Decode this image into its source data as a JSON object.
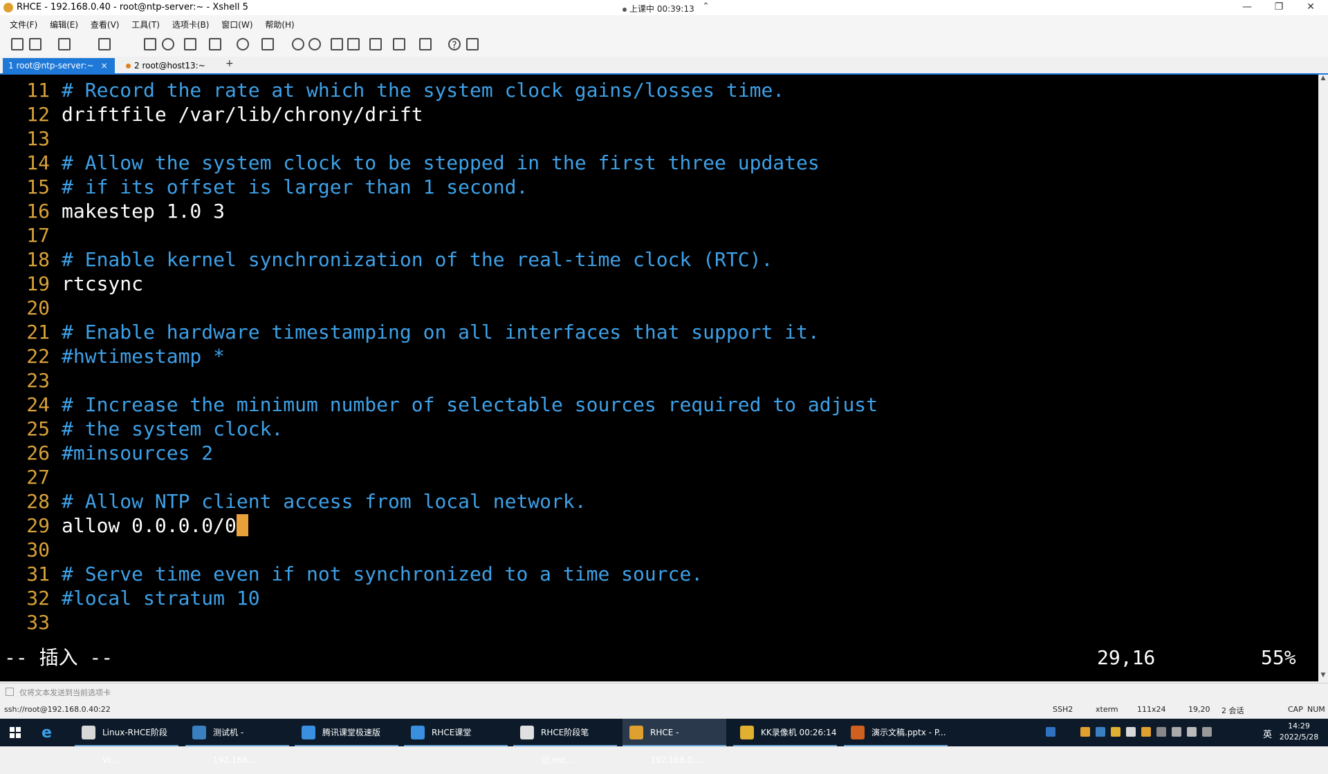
{
  "window": {
    "title": "RHCE - 192.168.0.40 - root@ntp-server:~ - Xshell 5",
    "session_status": "上课中 00:39:13",
    "minimize": "—",
    "restore": "❐",
    "close": "✕"
  },
  "menu": [
    "文件(F)",
    "编辑(E)",
    "查看(V)",
    "工具(T)",
    "选项卡(B)",
    "窗口(W)",
    "帮助(H)"
  ],
  "tabs": [
    {
      "label": "1 root@ntp-server:~",
      "close": "×",
      "active": true
    },
    {
      "label": "2 root@host13:~",
      "active": false
    }
  ],
  "tab_add": "+",
  "terminal": {
    "lines": [
      {
        "num": "11",
        "text": "# Record the rate at which the system clock gains/losses time.",
        "kind": "comment"
      },
      {
        "num": "12",
        "text": "driftfile /var/lib/chrony/drift",
        "kind": "text"
      },
      {
        "num": "13",
        "text": "",
        "kind": "text"
      },
      {
        "num": "14",
        "text": "# Allow the system clock to be stepped in the first three updates",
        "kind": "comment"
      },
      {
        "num": "15",
        "text": "# if its offset is larger than 1 second.",
        "kind": "comment"
      },
      {
        "num": "16",
        "text": "makestep 1.0 3",
        "kind": "text"
      },
      {
        "num": "17",
        "text": "",
        "kind": "text"
      },
      {
        "num": "18",
        "text": "# Enable kernel synchronization of the real-time clock (RTC).",
        "kind": "comment"
      },
      {
        "num": "19",
        "text": "rtcsync",
        "kind": "text"
      },
      {
        "num": "20",
        "text": "",
        "kind": "text"
      },
      {
        "num": "21",
        "text": "# Enable hardware timestamping on all interfaces that support it.",
        "kind": "comment"
      },
      {
        "num": "22",
        "text": "#hwtimestamp *",
        "kind": "comment"
      },
      {
        "num": "23",
        "text": "",
        "kind": "text"
      },
      {
        "num": "24",
        "text": "# Increase the minimum number of selectable sources required to adjust",
        "kind": "comment"
      },
      {
        "num": "25",
        "text": "# the system clock.",
        "kind": "comment"
      },
      {
        "num": "26",
        "text": "#minsources 2",
        "kind": "comment"
      },
      {
        "num": "27",
        "text": "",
        "kind": "text"
      },
      {
        "num": "28",
        "text": "# Allow NTP client access from local network.",
        "kind": "comment"
      },
      {
        "num": "29",
        "text": "allow 0.0.0.0/0",
        "kind": "text",
        "cursor": true
      },
      {
        "num": "30",
        "text": "",
        "kind": "text"
      },
      {
        "num": "31",
        "text": "# Serve time even if not synchronized to a time source.",
        "kind": "comment"
      },
      {
        "num": "32",
        "text": "#local stratum 10",
        "kind": "comment"
      },
      {
        "num": "33",
        "text": "",
        "kind": "text"
      }
    ],
    "mode": "-- 插入 --",
    "position": "29,16",
    "percent": "55%"
  },
  "compose_bar": "仅将文本发送到当前选项卡",
  "statusbar": {
    "address": "ssh://root@192.168.0.40:22",
    "protocol": "SSH2",
    "term": "xterm",
    "size": "111x24",
    "cursor": "19,20",
    "sessions": "2 会话",
    "cap": "CAP",
    "num": "NUM"
  },
  "taskbar": {
    "items": [
      {
        "label": "Linux-RHCE阶段VI...",
        "color": "#d8d8d8",
        "active": false
      },
      {
        "label": "测试机 - 192.168....",
        "color": "#3a7fc0",
        "active": false
      },
      {
        "label": "腾讯课堂极速版",
        "color": "#3a8fe0",
        "active": false
      },
      {
        "label": "RHCE课堂",
        "color": "#3a8fe0",
        "active": false
      },
      {
        "label": "RHCE阶段笔记.md...",
        "color": "#e0e0e0",
        "active": false
      },
      {
        "label": "RHCE - 192.168.0....",
        "color": "#e0a030",
        "active": true
      },
      {
        "label": "KK录像机 00:26:14",
        "color": "#e0b030",
        "active": false
      },
      {
        "label": "演示文稿.pptx - P...",
        "color": "#d06020",
        "active": false
      }
    ],
    "ime": "英",
    "time": "14:29",
    "date": "2022/5/28"
  }
}
